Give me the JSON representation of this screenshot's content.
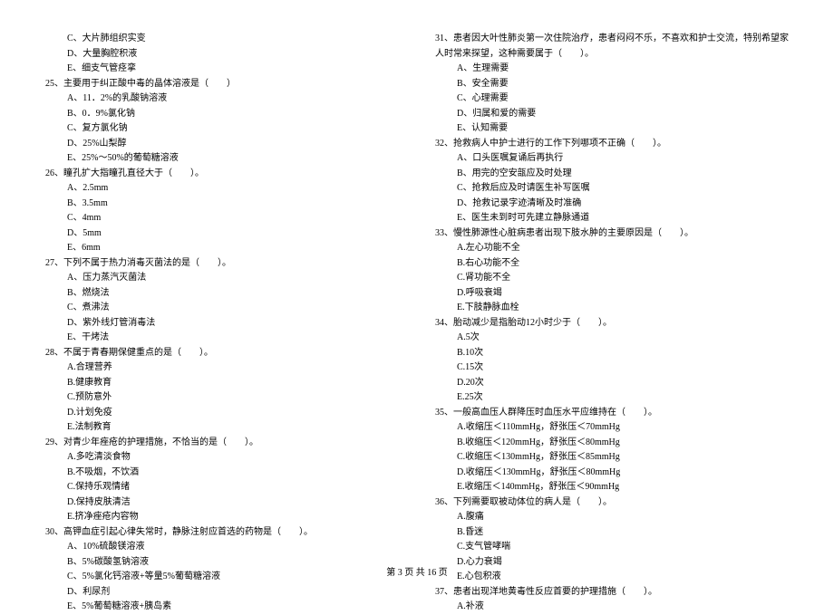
{
  "left_column": [
    {
      "type": "option",
      "text": "C、大片肺组织实变"
    },
    {
      "type": "option",
      "text": "D、大量胸腔积液"
    },
    {
      "type": "option",
      "text": "E、细支气管痉挛"
    },
    {
      "type": "question",
      "text": "25、主要用于纠正酸中毒的晶体溶液是（　　）"
    },
    {
      "type": "option",
      "text": "A、11．2%的乳酸钠溶液"
    },
    {
      "type": "option",
      "text": "B、0．9%氯化钠"
    },
    {
      "type": "option",
      "text": "C、复方氯化钠"
    },
    {
      "type": "option",
      "text": "D、25%山梨醇"
    },
    {
      "type": "option",
      "text": "E、25%～50%的葡萄糖溶液"
    },
    {
      "type": "question",
      "text": "26、瞳孔扩大指瞳孔直径大于（　　）。"
    },
    {
      "type": "option",
      "text": "A、2.5mm"
    },
    {
      "type": "option",
      "text": "B、3.5mm"
    },
    {
      "type": "option",
      "text": "C、4mm"
    },
    {
      "type": "option",
      "text": "D、5mm"
    },
    {
      "type": "option",
      "text": "E、6mm"
    },
    {
      "type": "question",
      "text": "27、下列不属于热力消毒灭菌法的是（　　）。"
    },
    {
      "type": "option",
      "text": "A、压力蒸汽灭菌法"
    },
    {
      "type": "option",
      "text": "B、燃烧法"
    },
    {
      "type": "option",
      "text": "C、煮沸法"
    },
    {
      "type": "option",
      "text": "D、紫外线灯管消毒法"
    },
    {
      "type": "option",
      "text": "E、干烤法"
    },
    {
      "type": "question",
      "text": "28、不属于青春期保健重点的是（　　）。"
    },
    {
      "type": "option",
      "text": "A.合理营养"
    },
    {
      "type": "option",
      "text": "B.健康教育"
    },
    {
      "type": "option",
      "text": "C.预防意外"
    },
    {
      "type": "option",
      "text": "D.计划免疫"
    },
    {
      "type": "option",
      "text": "E.法制教育"
    },
    {
      "type": "question",
      "text": "29、对青少年痤疮的护理措施，不恰当的是（　　）。"
    },
    {
      "type": "option",
      "text": "A.多吃清淡食物"
    },
    {
      "type": "option",
      "text": "B.不吸烟，不饮酒"
    },
    {
      "type": "option",
      "text": "C.保持乐观情绪"
    },
    {
      "type": "option",
      "text": "D.保持皮肤清洁"
    },
    {
      "type": "option",
      "text": "E.挤净痤疮内容物"
    },
    {
      "type": "question",
      "text": "30、高钾血症引起心律失常时，静脉注射应首选的药物是（　　）。"
    },
    {
      "type": "option",
      "text": "A、10%硫酸镁溶液"
    },
    {
      "type": "option",
      "text": "B、5%碳酸氢钠溶液"
    },
    {
      "type": "option",
      "text": "C、5%氯化钙溶液+等量5%葡萄糖溶液"
    },
    {
      "type": "option",
      "text": "D、利尿剂"
    },
    {
      "type": "option",
      "text": "E、5%葡萄糖溶液+胰岛素"
    }
  ],
  "right_column": [
    {
      "type": "question",
      "text": "31、患者因大叶性肺炎第一次住院治疗，患者闷闷不乐，不喜欢和护士交流，特别希望家人时常来探望，这种需要属于（　　）。"
    },
    {
      "type": "option",
      "text": "A、生理需要"
    },
    {
      "type": "option",
      "text": "B、安全需要"
    },
    {
      "type": "option",
      "text": "C、心理需要"
    },
    {
      "type": "option",
      "text": "D、归属和爱的需要"
    },
    {
      "type": "option",
      "text": "E、认知需要"
    },
    {
      "type": "question",
      "text": "32、抢救病人中护士进行的工作下列哪项不正确（　　）。"
    },
    {
      "type": "option",
      "text": "A、口头医嘱复诵后再执行"
    },
    {
      "type": "option",
      "text": "B、用完的空安瓿应及时处理"
    },
    {
      "type": "option",
      "text": "C、抢救后应及时请医生补写医嘱"
    },
    {
      "type": "option",
      "text": "D、抢救记录字迹清晰及时准确"
    },
    {
      "type": "option",
      "text": "E、医生未到时可先建立静脉通道"
    },
    {
      "type": "question",
      "text": "33、慢性肺源性心脏病患者出现下肢水肿的主要原因是（　　）。"
    },
    {
      "type": "option",
      "text": "A.左心功能不全"
    },
    {
      "type": "option",
      "text": "B.右心功能不全"
    },
    {
      "type": "option",
      "text": "C.肾功能不全"
    },
    {
      "type": "option",
      "text": "D.呼吸衰竭"
    },
    {
      "type": "option",
      "text": "E.下肢静脉血栓"
    },
    {
      "type": "question",
      "text": "34、胎动减少是指胎动12小时少于（　　）。"
    },
    {
      "type": "option",
      "text": "A.5次"
    },
    {
      "type": "option",
      "text": "B.10次"
    },
    {
      "type": "option",
      "text": "C.15次"
    },
    {
      "type": "option",
      "text": "D.20次"
    },
    {
      "type": "option",
      "text": "E.25次"
    },
    {
      "type": "question",
      "text": "35、一般高血压人群降压时血压水平应维持在（　　）。"
    },
    {
      "type": "option",
      "text": "A.收缩压＜110mmHg，舒张压＜70mmHg"
    },
    {
      "type": "option",
      "text": "B.收缩压＜120mmHg，舒张压＜80mmHg"
    },
    {
      "type": "option",
      "text": "C.收缩压＜130mmHg，舒张压＜85mmHg"
    },
    {
      "type": "option",
      "text": "D.收缩压＜130mmHg，舒张压＜80mmHg"
    },
    {
      "type": "option",
      "text": "E.收缩压＜140mmHg，舒张压＜90mmHg"
    },
    {
      "type": "question",
      "text": "36、下列需要取被动体位的病人是（　　）。"
    },
    {
      "type": "option",
      "text": "A.腹痛"
    },
    {
      "type": "option",
      "text": "B.昏迷"
    },
    {
      "type": "option",
      "text": "C.支气管哮喘"
    },
    {
      "type": "option",
      "text": "D.心力衰竭"
    },
    {
      "type": "option",
      "text": "E.心包积液"
    },
    {
      "type": "question",
      "text": "37、患者出现洋地黄毒性反应首要的护理措施（　　）。"
    },
    {
      "type": "option",
      "text": "A.补液"
    }
  ],
  "footer": "第 3 页 共 16 页"
}
